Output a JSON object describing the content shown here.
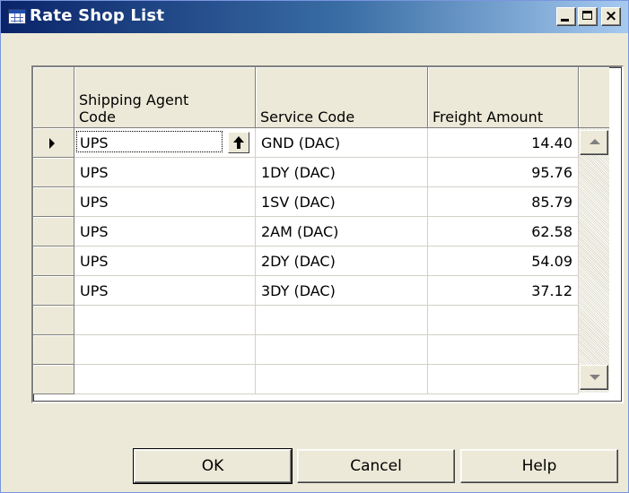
{
  "window": {
    "title": "Rate Shop List"
  },
  "grid": {
    "columns": [
      {
        "label": "Shipping Agent Code",
        "line1": "Shipping Agent",
        "line2": "Code"
      },
      {
        "label": "Service Code"
      },
      {
        "label": "Freight Amount"
      }
    ],
    "rows": [
      {
        "agent": "UPS",
        "service": "GND (DAC)",
        "amount": "14.40"
      },
      {
        "agent": "UPS",
        "service": "1DY (DAC)",
        "amount": "95.76"
      },
      {
        "agent": "UPS",
        "service": "1SV (DAC)",
        "amount": "85.79"
      },
      {
        "agent": "UPS",
        "service": "2AM (DAC)",
        "amount": "62.58"
      },
      {
        "agent": "UPS",
        "service": "2DY (DAC)",
        "amount": "54.09"
      },
      {
        "agent": "UPS",
        "service": "3DY (DAC)",
        "amount": "37.12"
      },
      {
        "agent": "",
        "service": "",
        "amount": ""
      },
      {
        "agent": "",
        "service": "",
        "amount": ""
      },
      {
        "agent": "",
        "service": "",
        "amount": ""
      }
    ],
    "current_row": 0
  },
  "buttons": {
    "ok": "OK",
    "cancel": "Cancel",
    "help": "Help"
  },
  "colors": {
    "titlebar_start": "#0a246a",
    "titlebar_end": "#a6caf0",
    "dialog_bg": "#ece9d8"
  },
  "icons": {
    "app": "table-icon",
    "lookup": "up-arrow-icon",
    "row_selector": "current-row-arrow-icon"
  }
}
